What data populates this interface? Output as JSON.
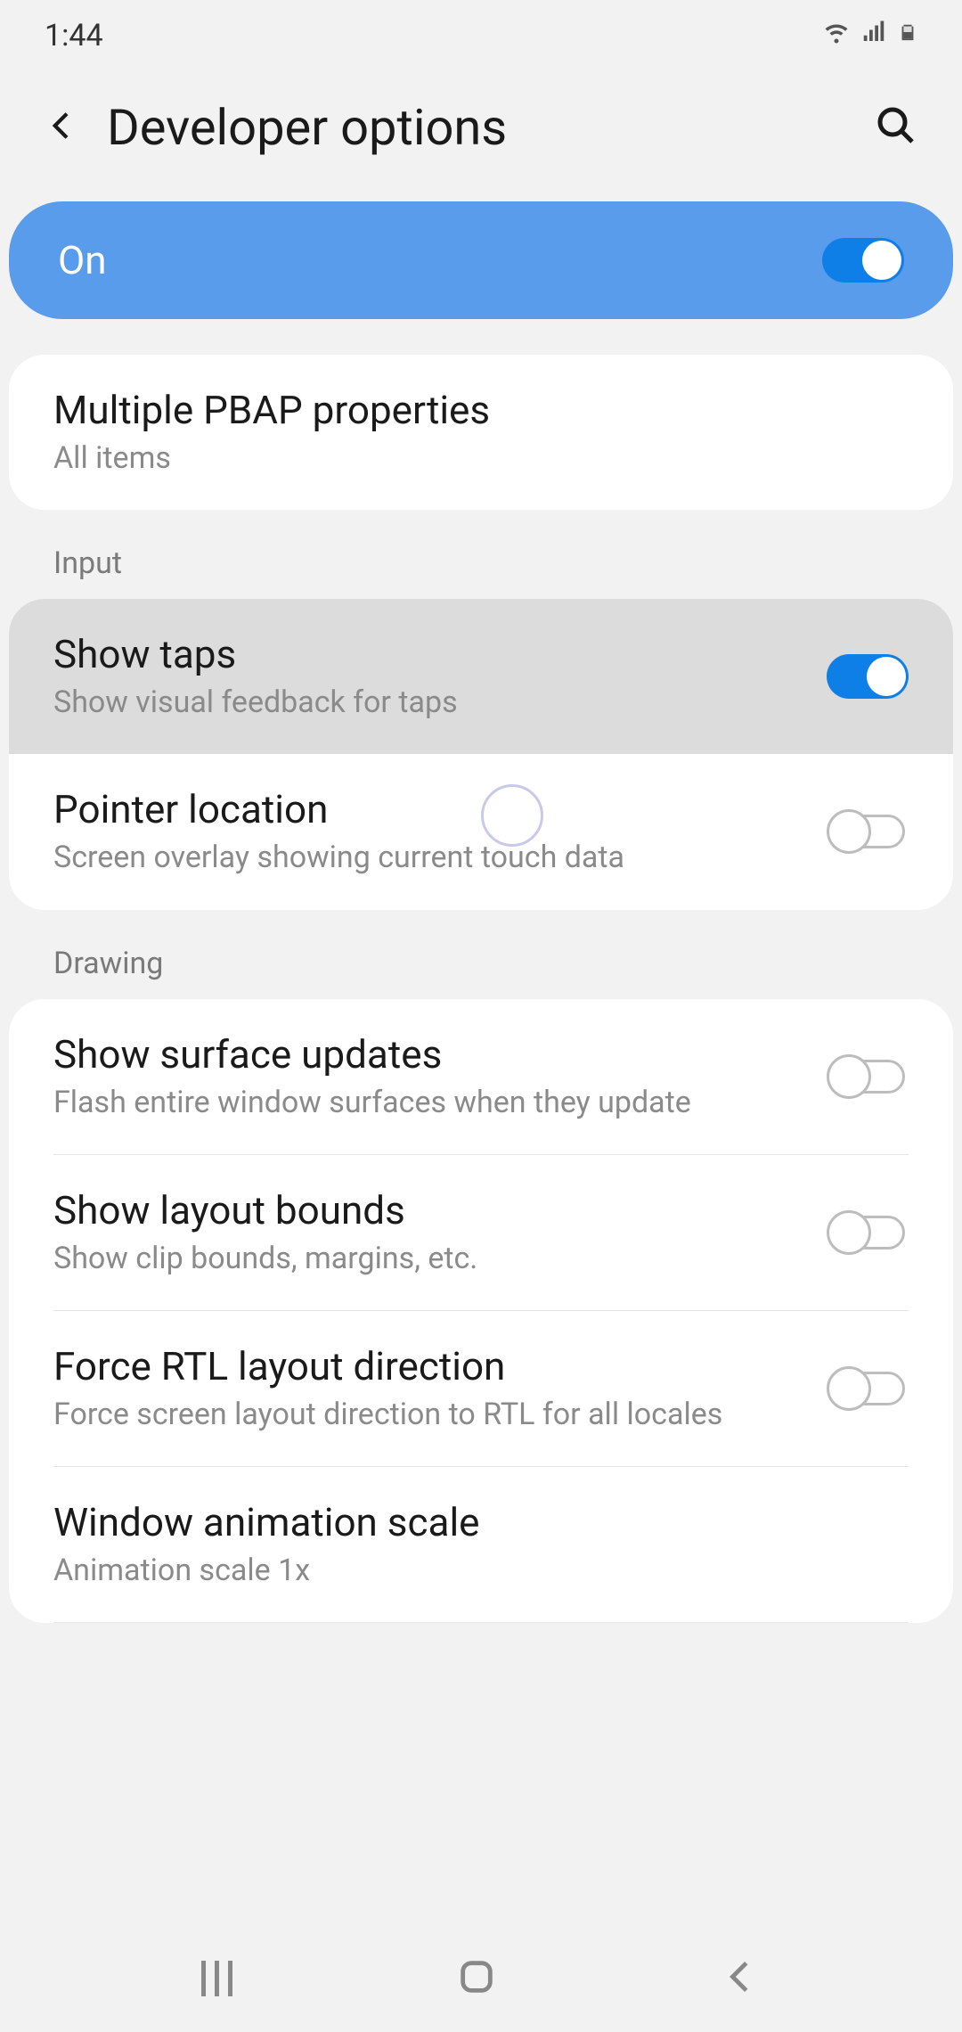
{
  "status": {
    "time": "1:44"
  },
  "header": {
    "title": "Developer options"
  },
  "master": {
    "label": "On",
    "on": true
  },
  "group_pbap": {
    "title": "Multiple PBAP properties",
    "sub": "All items"
  },
  "section_input": "Input",
  "row_show_taps": {
    "title": "Show taps",
    "sub": "Show visual feedback for taps",
    "on": true
  },
  "row_pointer": {
    "title": "Pointer location",
    "sub": "Screen overlay showing current touch data",
    "on": false
  },
  "section_drawing": "Drawing",
  "row_surface": {
    "title": "Show surface updates",
    "sub": "Flash entire window surfaces when they update",
    "on": false
  },
  "row_layout": {
    "title": "Show layout bounds",
    "sub": "Show clip bounds, margins, etc.",
    "on": false
  },
  "row_rtl": {
    "title": "Force RTL layout direction",
    "sub": "Force screen layout direction to RTL for all locales",
    "on": false
  },
  "row_window_anim": {
    "title": "Window animation scale",
    "sub": "Animation scale 1x"
  }
}
